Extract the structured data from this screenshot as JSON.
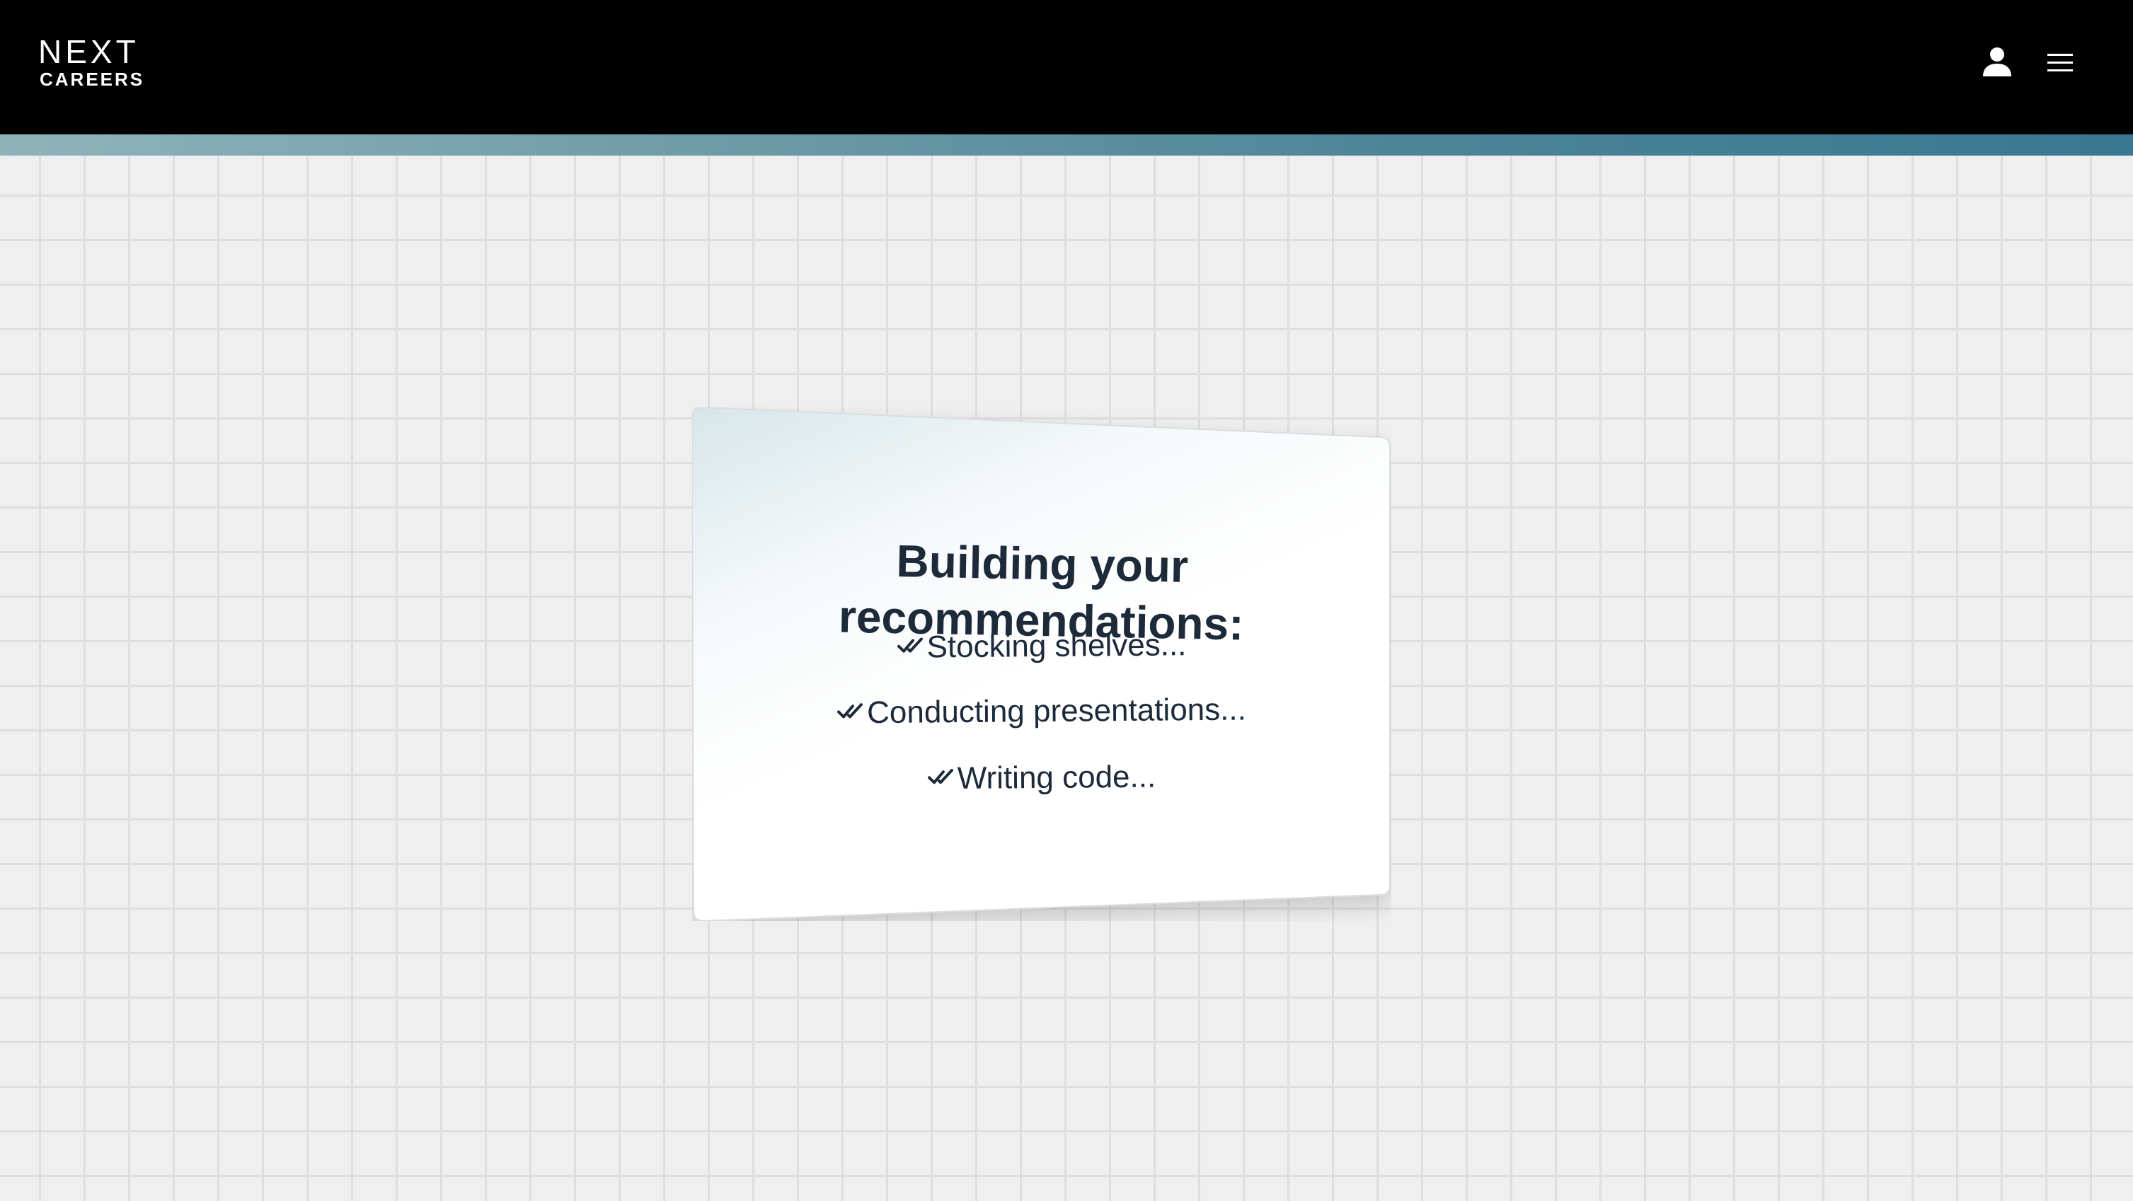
{
  "header": {
    "logo": {
      "main": "NEXT",
      "sub": "CAREERS"
    },
    "account_icon": "user-icon",
    "menu_icon": "hamburger-menu-icon"
  },
  "card": {
    "title": "Building your recommendations:",
    "steps": [
      {
        "label": "Stocking shelves...",
        "icon": "double-check-icon"
      },
      {
        "label": "Conducting presentations...",
        "icon": "double-check-icon"
      },
      {
        "label": "Writing code...",
        "icon": "double-check-icon"
      }
    ]
  },
  "colors": {
    "header_bg": "#000000",
    "text_dark": "#1c2a3a",
    "accent_start": "#8fb3bb",
    "accent_end": "#3a7790",
    "tile_bg": "#efefef",
    "tile_line": "#dedede"
  }
}
